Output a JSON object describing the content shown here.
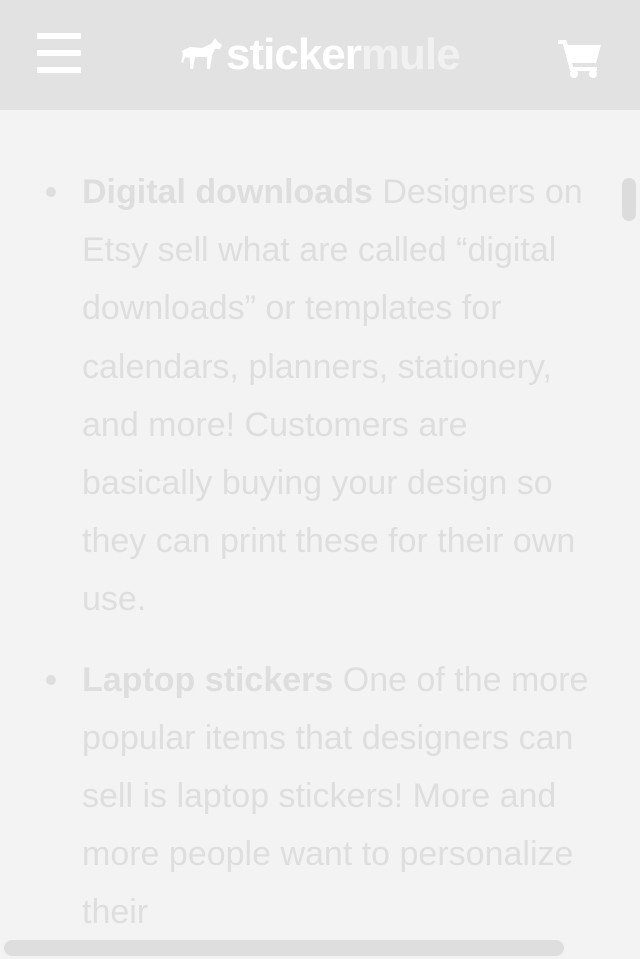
{
  "header": {
    "logo_part1": "sticker",
    "logo_part2": "mule",
    "menu_icon": "hamburger-menu-icon",
    "cart_icon": "shopping-cart-icon",
    "logo_icon": "mule-icon"
  },
  "article": {
    "items": [
      {
        "title": "Digital downloads",
        "text": "Designers on Etsy sell what are called “digital downloads” or templates for calendars, planners, stationery, and more! Customers are basically buying your design so they can print these for their own use."
      },
      {
        "title": "Laptop stickers",
        "text": "One of the more popular items that designers can sell is laptop stickers! More and more people want to personalize their"
      }
    ]
  },
  "colors": {
    "header_bg": "#e2e2e2",
    "page_bg": "#f3f3f3",
    "text": "#dedede"
  }
}
